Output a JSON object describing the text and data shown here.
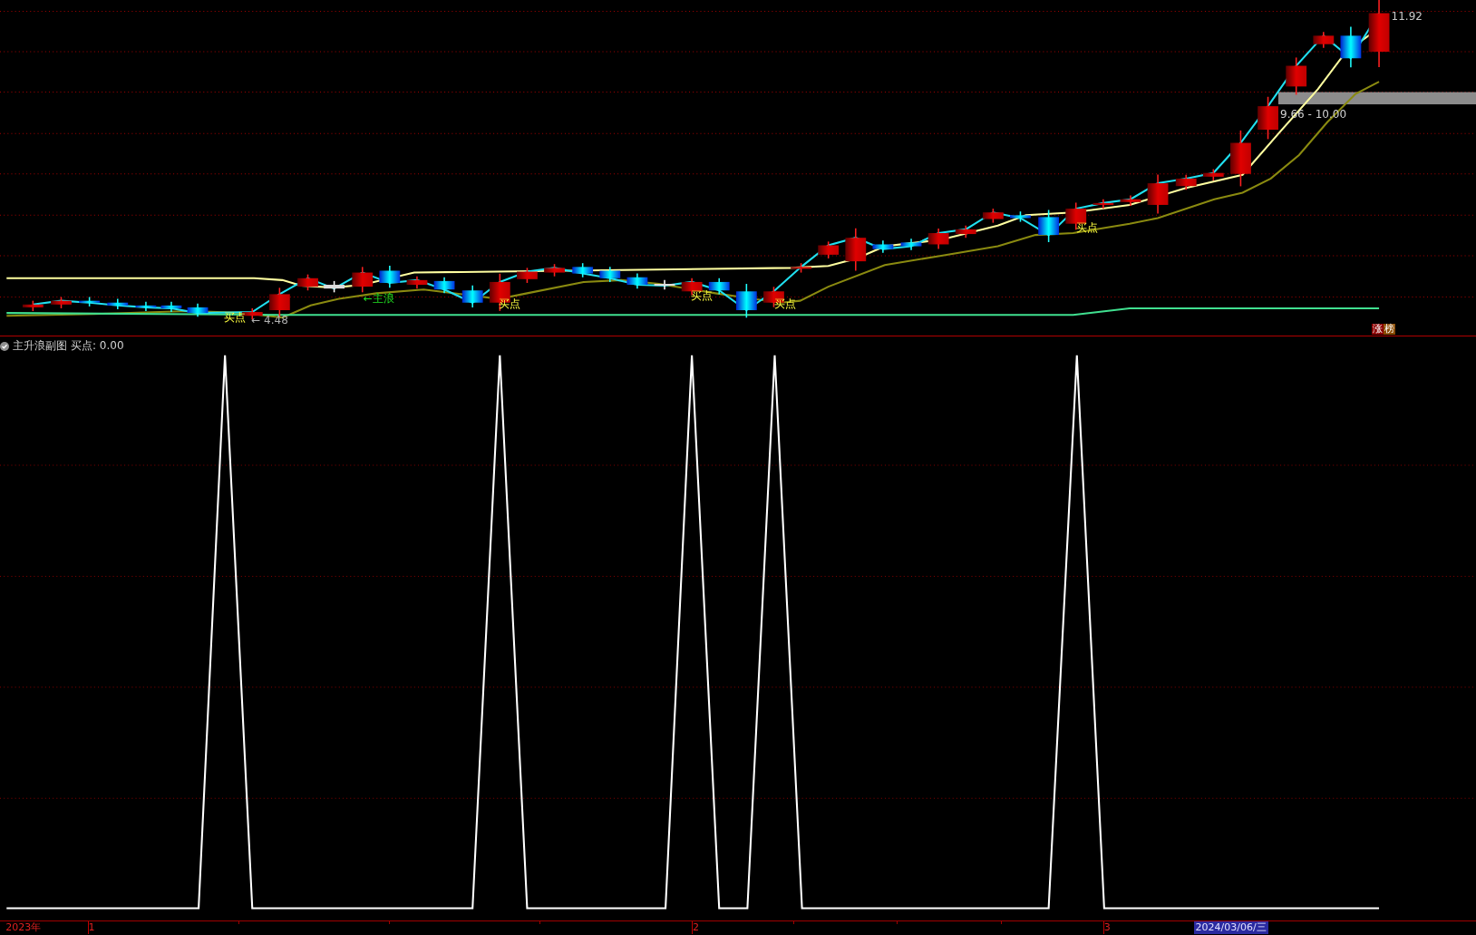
{
  "price_chart": {
    "high_label": "11.92",
    "range_label": "9.66 - 10.00",
    "low_label": "← 4.48",
    "wave_label": "←主浪",
    "buy_labels": [
      "买点",
      "买点",
      "买点",
      "买点",
      "买点"
    ],
    "badges": [
      {
        "text": "涨",
        "kind": "limit"
      },
      {
        "text": "榜",
        "kind": "rank"
      }
    ]
  },
  "indicator": {
    "title": "主升浪副图",
    "reading": "买点: 0.00"
  },
  "time_axis": {
    "labels": [
      "2023年",
      "1",
      "2",
      "3"
    ],
    "cursor_date": "2024/03/06/三"
  }
}
